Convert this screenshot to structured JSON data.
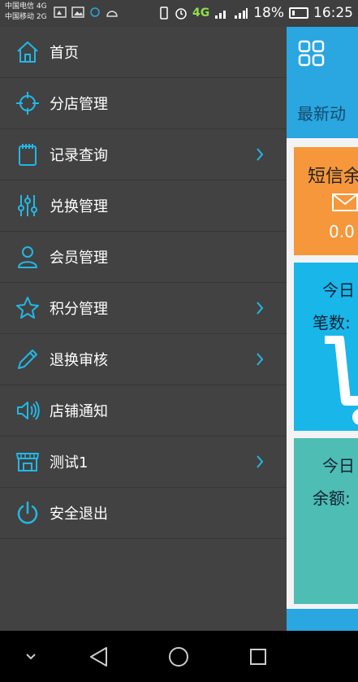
{
  "status_bar": {
    "carrier1": "中国电信 4G",
    "carrier2": "中国移动 2G",
    "network": "4G",
    "battery": "18%",
    "time": "16:25"
  },
  "drawer": {
    "items": [
      {
        "label": "首页",
        "icon": "home-icon",
        "has_arrow": false
      },
      {
        "label": "分店管理",
        "icon": "crosshair-icon",
        "has_arrow": false
      },
      {
        "label": "记录查询",
        "icon": "notepad-icon",
        "has_arrow": true
      },
      {
        "label": "兑换管理",
        "icon": "sliders-icon",
        "has_arrow": false
      },
      {
        "label": "会员管理",
        "icon": "user-icon",
        "has_arrow": false
      },
      {
        "label": "积分管理",
        "icon": "star-icon",
        "has_arrow": true
      },
      {
        "label": "退换审核",
        "icon": "pencil-icon",
        "has_arrow": true
      },
      {
        "label": "店铺通知",
        "icon": "speaker-icon",
        "has_arrow": false
      },
      {
        "label": "测试1",
        "icon": "store-icon",
        "has_arrow": true
      },
      {
        "label": "安全退出",
        "icon": "power-icon",
        "has_arrow": false
      }
    ]
  },
  "content": {
    "latest_title": "最新动",
    "sms_card": {
      "title": "短信余",
      "value": "0.0"
    },
    "today_card1": {
      "title": "今日",
      "label": "笔数:"
    },
    "today_card2": {
      "title": "今日",
      "label": "余额:"
    }
  },
  "colors": {
    "accent": "#21b8e6",
    "drawer_bg": "#424242",
    "sms_card": "#f5973a",
    "today_card1": "#19b6ea",
    "today_card2": "#4ebdb3"
  }
}
